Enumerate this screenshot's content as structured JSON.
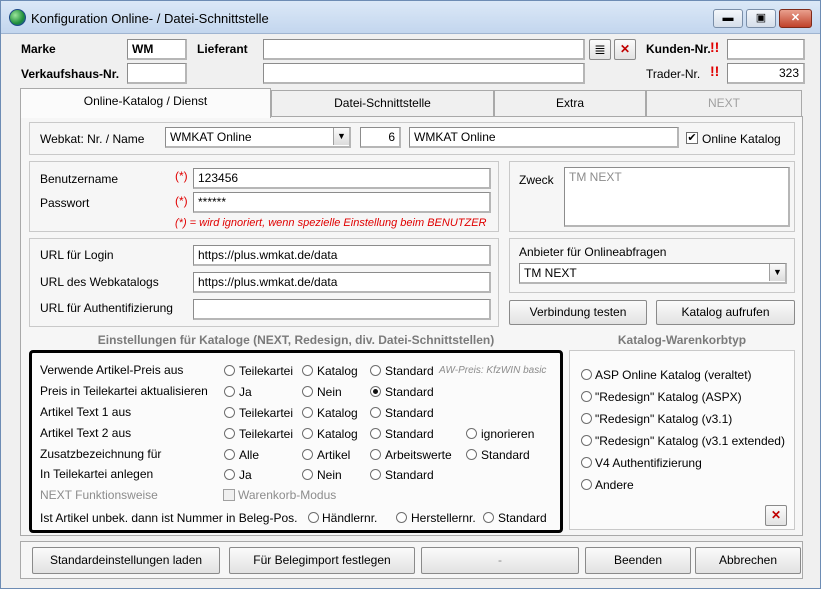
{
  "window": {
    "title": "Konfiguration Online- / Datei-Schnittstelle",
    "min": "▬",
    "max": "▣",
    "close": "✕"
  },
  "header": {
    "marke_label": "Marke",
    "marke_value": "WM",
    "lieferant_label": "Lieferant",
    "lieferant_value": "",
    "verkaufshaus_label": "Verkaufshaus-Nr.",
    "verkaufshaus_value": "",
    "lieferant2_value": "",
    "kunden_label": "Kunden-Nr.",
    "kunden_value": "",
    "trader_label": "Trader-Nr.",
    "trader_value": "323",
    "excl": "!!",
    "list_btn": "≣",
    "x_btn": "✕"
  },
  "tabs": [
    "Online-Katalog / Dienst",
    "Datei-Schnittstelle",
    "Extra",
    "NEXT"
  ],
  "webkat": {
    "label": "Webkat: Nr. / Name",
    "combo": "WMKAT Online",
    "nr": "6",
    "name": "WMKAT Online",
    "online_katalog_label": "Online Katalog",
    "online_katalog_checked": true
  },
  "credentials": {
    "user_label": "Benutzername",
    "user_value": "123456",
    "pass_label": "Passwort",
    "pass_value": "******",
    "star": "(*)",
    "note": "(*) = wird ignoriert, wenn spezielle Einstellung beim BENUTZER"
  },
  "zweck": {
    "label": "Zweck",
    "value": "TM NEXT"
  },
  "urls": {
    "login_label": "URL für Login",
    "login_value": "https://plus.wmkat.de/data",
    "webkat_label": "URL des Webkatalogs",
    "webkat_value": "https://plus.wmkat.de/data",
    "auth_label": "URL für Authentifizierung",
    "auth_value": ""
  },
  "anbieter": {
    "label": "Anbieter für Onlineabfragen",
    "value": "TM NEXT"
  },
  "buttons": {
    "verbindung": "Verbindung testen",
    "katalog": "Katalog aufrufen"
  },
  "settings": {
    "heading": "Einstellungen für Kataloge (NEXT, Redesign, div. Datei-Schnittstellen)",
    "rows": [
      {
        "label": "Verwende Artikel-Preis aus",
        "options": [
          "Teilekartei",
          "Katalog",
          "Standard"
        ],
        "selected": -1,
        "note": "AW-Preis: KfzWIN basic"
      },
      {
        "label": "Preis in Teilekartei aktualisieren",
        "options": [
          "Ja",
          "Nein",
          "Standard"
        ],
        "selected": 2
      },
      {
        "label": "Artikel Text 1 aus",
        "options": [
          "Teilekartei",
          "Katalog",
          "Standard"
        ],
        "selected": -1
      },
      {
        "label": "Artikel Text 2 aus",
        "options": [
          "Teilekartei",
          "Katalog",
          "Standard",
          "ignorieren"
        ],
        "selected": -1
      },
      {
        "label": "Zusatzbezeichnung für",
        "options": [
          "Alle",
          "Artikel",
          "Arbeitswerte",
          "Standard"
        ],
        "selected": -1
      },
      {
        "label": "In Teilekartei anlegen",
        "options": [
          "Ja",
          "Nein",
          "Standard"
        ],
        "selected": -1
      }
    ],
    "next_label": "NEXT Funktionsweise",
    "warenkorb": "Warenkorb-Modus",
    "unbek_label": "Ist Artikel unbek. dann ist Nummer in Beleg-Pos.",
    "unbek_options": [
      "Händlernr.",
      "Herstellernr.",
      "Standard"
    ]
  },
  "warenkorb": {
    "heading": "Katalog-Warenkorbtyp",
    "options": [
      "ASP Online Katalog (veraltet)",
      "\"Redesign\" Katalog (ASPX)",
      "\"Redesign\" Katalog (v3.1)",
      "\"Redesign\" Katalog (v3.1 extended)",
      "V4 Authentifizierung",
      "Andere"
    ],
    "clear": "✕"
  },
  "footer": {
    "std": "Standardeinstellungen laden",
    "beleg": "Für Belegimport festlegen",
    "dash": "-",
    "beenden": "Beenden",
    "abbrechen": "Abbrechen"
  }
}
